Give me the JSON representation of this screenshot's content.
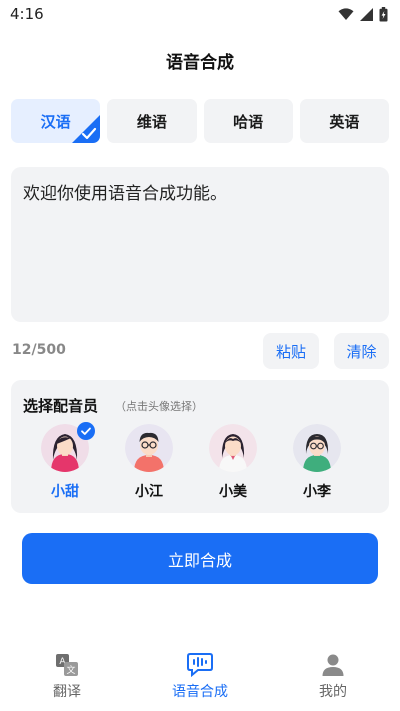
{
  "status": {
    "time": "4:16"
  },
  "header": {
    "title": "语音合成"
  },
  "language_tabs": [
    {
      "label": "汉语",
      "selected": true
    },
    {
      "label": "维语",
      "selected": false
    },
    {
      "label": "哈语",
      "selected": false
    },
    {
      "label": "英语",
      "selected": false
    }
  ],
  "editor": {
    "text": "欢迎你使用语音合成功能。",
    "char_count": "12/500",
    "paste_label": "粘贴",
    "clear_label": "清除"
  },
  "voice_select": {
    "title": "选择配音员",
    "hint": "（点击头像选择）",
    "voices": [
      {
        "name": "小甜",
        "selected": true
      },
      {
        "name": "小江",
        "selected": false
      },
      {
        "name": "小美",
        "selected": false
      },
      {
        "name": "小李",
        "selected": false
      }
    ]
  },
  "synthesize_label": "立即合成",
  "bottom_nav": [
    {
      "label": "翻译",
      "icon": "translate-icon",
      "active": false
    },
    {
      "label": "语音合成",
      "icon": "voice-synthesis-icon",
      "active": true
    },
    {
      "label": "我的",
      "icon": "profile-icon",
      "active": false
    }
  ],
  "colors": {
    "accent": "#1a6ef5",
    "panel": "#f2f3f5"
  }
}
